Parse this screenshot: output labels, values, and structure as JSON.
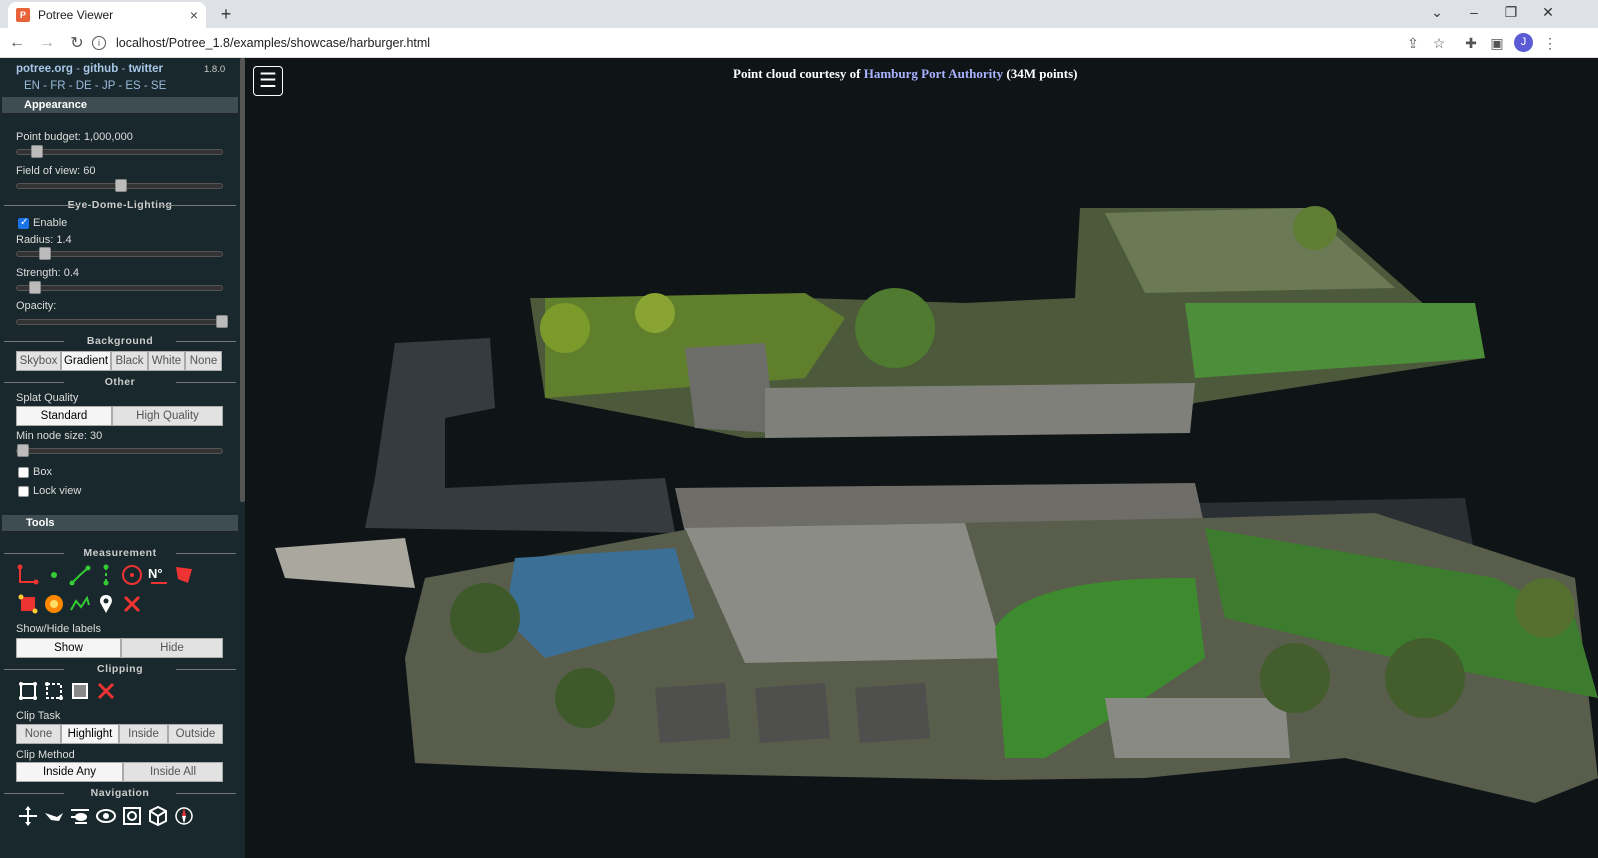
{
  "browser": {
    "tab_title": "Potree Viewer",
    "tab_close": "×",
    "new_tab": "+",
    "url": "localhost/Potree_1.8/examples/showcase/harburger.html",
    "profile_initial": "J",
    "window_controls": [
      "⌄",
      "–",
      "❐",
      "✕"
    ]
  },
  "sidebar": {
    "links": [
      "potree.org",
      "github",
      "twitter"
    ],
    "link_sep": " - ",
    "version": "1.8.0",
    "languages": "EN - FR - DE - JP - ES - SE",
    "appearance_title": "Appearance",
    "point_budget": "Point budget: 1,000,000",
    "point_budget_level": 0.1,
    "fov": "Field of view: 60",
    "fov_level": 0.5,
    "edl_title": "Eye-Dome-Lighting",
    "edl_enable": "Enable",
    "radius": "Radius: 1.4",
    "radius_level": 0.12,
    "strength": "Strength: 0.4",
    "strength_level": 0.08,
    "opacity": "Opacity:",
    "opacity_level": 1.0,
    "background_title": "Background",
    "background_options": [
      "Skybox",
      "Gradient",
      "Black",
      "White",
      "None"
    ],
    "background_selected": "Gradient",
    "other_title": "Other",
    "splat_quality": "Splat Quality",
    "splat_options": [
      "Standard",
      "High Quality"
    ],
    "splat_selected": "Standard",
    "min_node_size": "Min node size: 30",
    "min_node_level": 0.0,
    "box_label": "Box",
    "lock_view_label": "Lock view",
    "tools_title": "Tools",
    "measurement_title": "Measurement",
    "show_hide_labels": "Show/Hide labels",
    "label_options": [
      "Show",
      "Hide"
    ],
    "label_selected": "Show",
    "clipping_title": "Clipping",
    "clip_task": "Clip Task",
    "clip_task_options": [
      "None",
      "Highlight",
      "Inside",
      "Outside"
    ],
    "clip_task_selected": "Highlight",
    "clip_method": "Clip Method",
    "clip_method_options": [
      "Inside Any",
      "Inside All"
    ],
    "clip_method_selected": "Inside Any",
    "navigation_title": "Navigation"
  },
  "viewer": {
    "menu_icon": "☰",
    "courtesy_prefix": "Point cloud courtesy of ",
    "courtesy_link": "Hamburg Port Authority",
    "courtesy_suffix": " (34M points)"
  }
}
